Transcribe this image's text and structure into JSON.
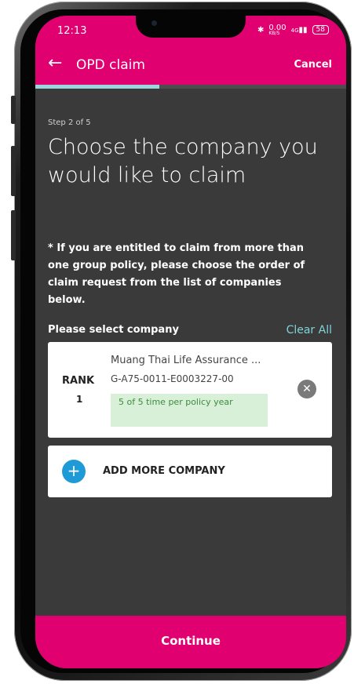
{
  "status_bar": {
    "time": "12:13",
    "network_speed": "0.00",
    "network_unit": "KB/S",
    "signal": "4G",
    "battery": "58"
  },
  "app_bar": {
    "title": "OPD claim",
    "cancel_label": "Cancel",
    "back_icon": "arrow-left-icon"
  },
  "progress": {
    "current_step": 2,
    "total_steps": 5,
    "fraction": 0.4
  },
  "step_text": "Step 2 of 5",
  "heading": "Choose the company you would like to claim",
  "notice": "* If you are entitled to claim from more than one group policy, please choose the order of claim request from the list of companies below.",
  "select_section": {
    "label": "Please select company",
    "clear_all": "Clear All"
  },
  "companies": [
    {
      "rank_label": "RANK",
      "rank": "1",
      "name": "Muang Thai Life Assurance ...",
      "policy_no": "G-A75-0011-E0003227-00",
      "usage": "5 of 5 time per policy year"
    }
  ],
  "add_company": {
    "label": "ADD MORE COMPANY",
    "icon": "plus-icon"
  },
  "continue_label": "Continue",
  "colors": {
    "brand": "#e0006f",
    "accent": "#7fd3db",
    "background": "#3a3a3a",
    "plus_button": "#1e9bd7",
    "usage_badge_bg": "#d8f0d8",
    "usage_badge_text": "#3f8a3f"
  }
}
